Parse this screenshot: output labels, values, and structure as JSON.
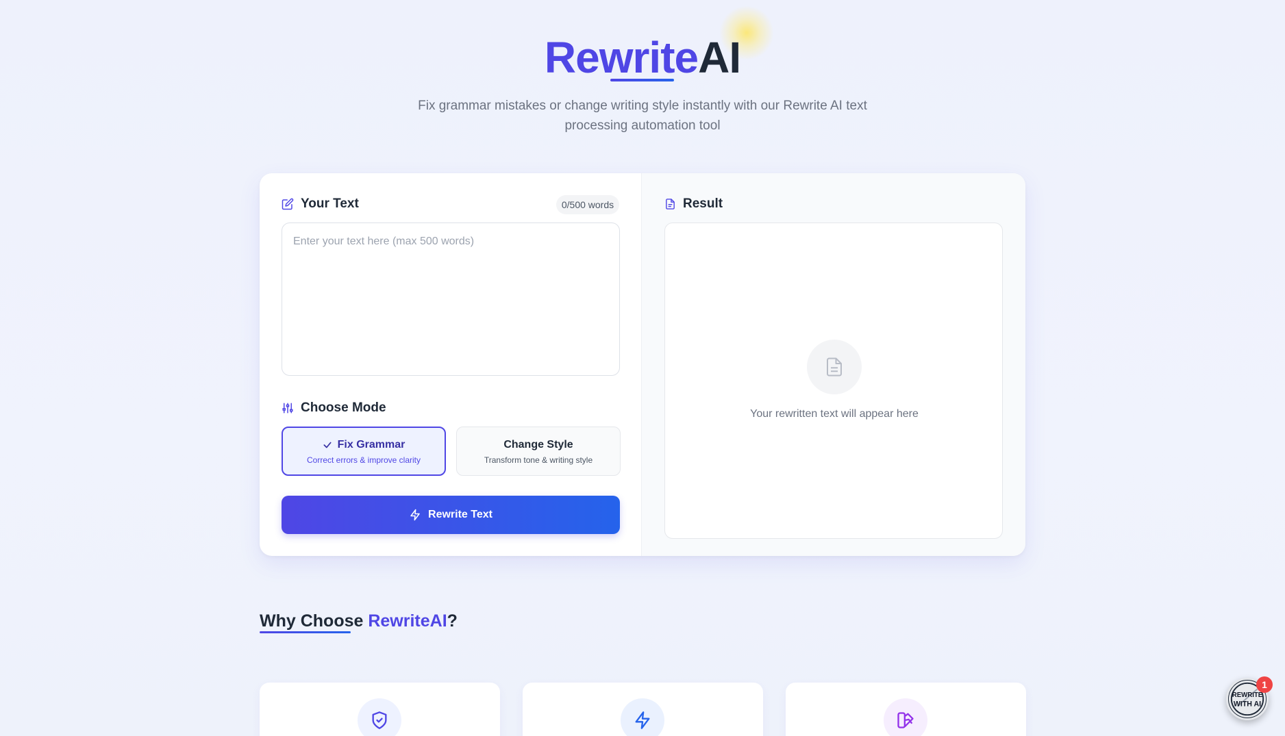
{
  "header": {
    "logo_part1": "Rewrite",
    "logo_part2": "AI",
    "tagline": "Fix grammar mistakes or change writing style instantly with our Rewrite AI text processing automation tool"
  },
  "input_panel": {
    "label": "Your Text",
    "word_count": "0/500 words",
    "placeholder": "Enter your text here (max 500 words)",
    "value": ""
  },
  "mode": {
    "label": "Choose Mode",
    "selected": "fix_grammar",
    "options": [
      {
        "id": "fix_grammar",
        "title": "Fix Grammar",
        "subtitle": "Correct errors & improve clarity"
      },
      {
        "id": "change_style",
        "title": "Change Style",
        "subtitle": "Transform tone & writing style"
      }
    ]
  },
  "action": {
    "label": "Rewrite Text"
  },
  "result_panel": {
    "label": "Result",
    "placeholder": "Your rewritten text will appear here"
  },
  "why": {
    "prefix": "Why Choose ",
    "accent": "RewriteAI",
    "suffix": "?"
  },
  "features": [
    {
      "icon": "shield-check-icon"
    },
    {
      "icon": "lightning-icon"
    },
    {
      "icon": "swatch-icon"
    }
  ],
  "chat_widget": {
    "badge_count": "1",
    "avatar_text": "REWRITE WITH AI"
  },
  "colors": {
    "primary": "#4f46e5",
    "secondary": "#2563eb",
    "badge": "#ef4444"
  }
}
